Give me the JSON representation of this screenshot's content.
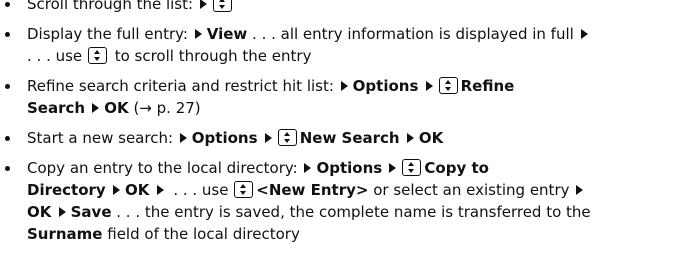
{
  "items": [
    {
      "lines": [
        [
          {
            "t": "text",
            "v": "Scroll through the list: "
          },
          {
            "t": "tri"
          },
          {
            "t": "key"
          }
        ]
      ]
    },
    {
      "lines": [
        [
          {
            "t": "text",
            "v": "Display the full entry: "
          },
          {
            "t": "tri"
          },
          {
            "t": "bold",
            "v": "View"
          },
          {
            "t": "text",
            "v": " . . . all entry information is displayed in full "
          },
          {
            "t": "tri"
          }
        ],
        [
          {
            "t": "text",
            "v": ". . . use "
          },
          {
            "t": "key"
          },
          {
            "t": "text",
            "v": " to scroll through the entry"
          }
        ]
      ]
    },
    {
      "lines": [
        [
          {
            "t": "text",
            "v": "Refine search criteria and restrict hit list:  "
          },
          {
            "t": "tri"
          },
          {
            "t": "bold",
            "v": "Options "
          },
          {
            "t": "tri"
          },
          {
            "t": "key"
          },
          {
            "t": "bold",
            "v": "Refine"
          }
        ],
        [
          {
            "t": "bold",
            "v": "Search "
          },
          {
            "t": "tri"
          },
          {
            "t": "bold",
            "v": "OK"
          },
          {
            "t": "text",
            "v": " ("
          },
          {
            "t": "arrow",
            "v": "→"
          },
          {
            "t": "text",
            "v": " p. 27)"
          }
        ]
      ]
    },
    {
      "lines": [
        [
          {
            "t": "text",
            "v": "Start a new search: "
          },
          {
            "t": "tri"
          },
          {
            "t": "bold",
            "v": "Options "
          },
          {
            "t": "tri"
          },
          {
            "t": "key"
          },
          {
            "t": "bold",
            "v": "New Search "
          },
          {
            "t": "tri"
          },
          {
            "t": "bold",
            "v": "OK"
          }
        ]
      ]
    },
    {
      "lines": [
        [
          {
            "t": "text",
            "v": "Copy an entry to the local directory: "
          },
          {
            "t": "tri"
          },
          {
            "t": "bold",
            "v": "Options "
          },
          {
            "t": "tri"
          },
          {
            "t": "key"
          },
          {
            "t": "bold",
            "v": "Copy to"
          }
        ],
        [
          {
            "t": "bold",
            "v": "Directory "
          },
          {
            "t": "tri"
          },
          {
            "t": "bold",
            "v": "OK "
          },
          {
            "t": "tri"
          },
          {
            "t": "text",
            "v": " . . . use "
          },
          {
            "t": "key"
          },
          {
            "t": "bold",
            "v": "<New Entry>"
          },
          {
            "t": "text",
            "v": " or select an existing entry "
          },
          {
            "t": "tri"
          }
        ],
        [
          {
            "t": "bold",
            "v": "OK "
          },
          {
            "t": "tri"
          },
          {
            "t": "bold",
            "v": "Save"
          },
          {
            "t": "text",
            "v": " . . . the entry is saved, the complete name is transferred to the"
          }
        ],
        [
          {
            "t": "bold",
            "v": "Surname"
          },
          {
            "t": "text",
            "v": " field of the local directory"
          }
        ]
      ]
    }
  ],
  "icons": {
    "bullet": "bullet-dot-icon",
    "tri": "right-triangle-icon",
    "key": "up-down-navigation-key-icon",
    "arrow": "arrow-right-reference-icon"
  }
}
